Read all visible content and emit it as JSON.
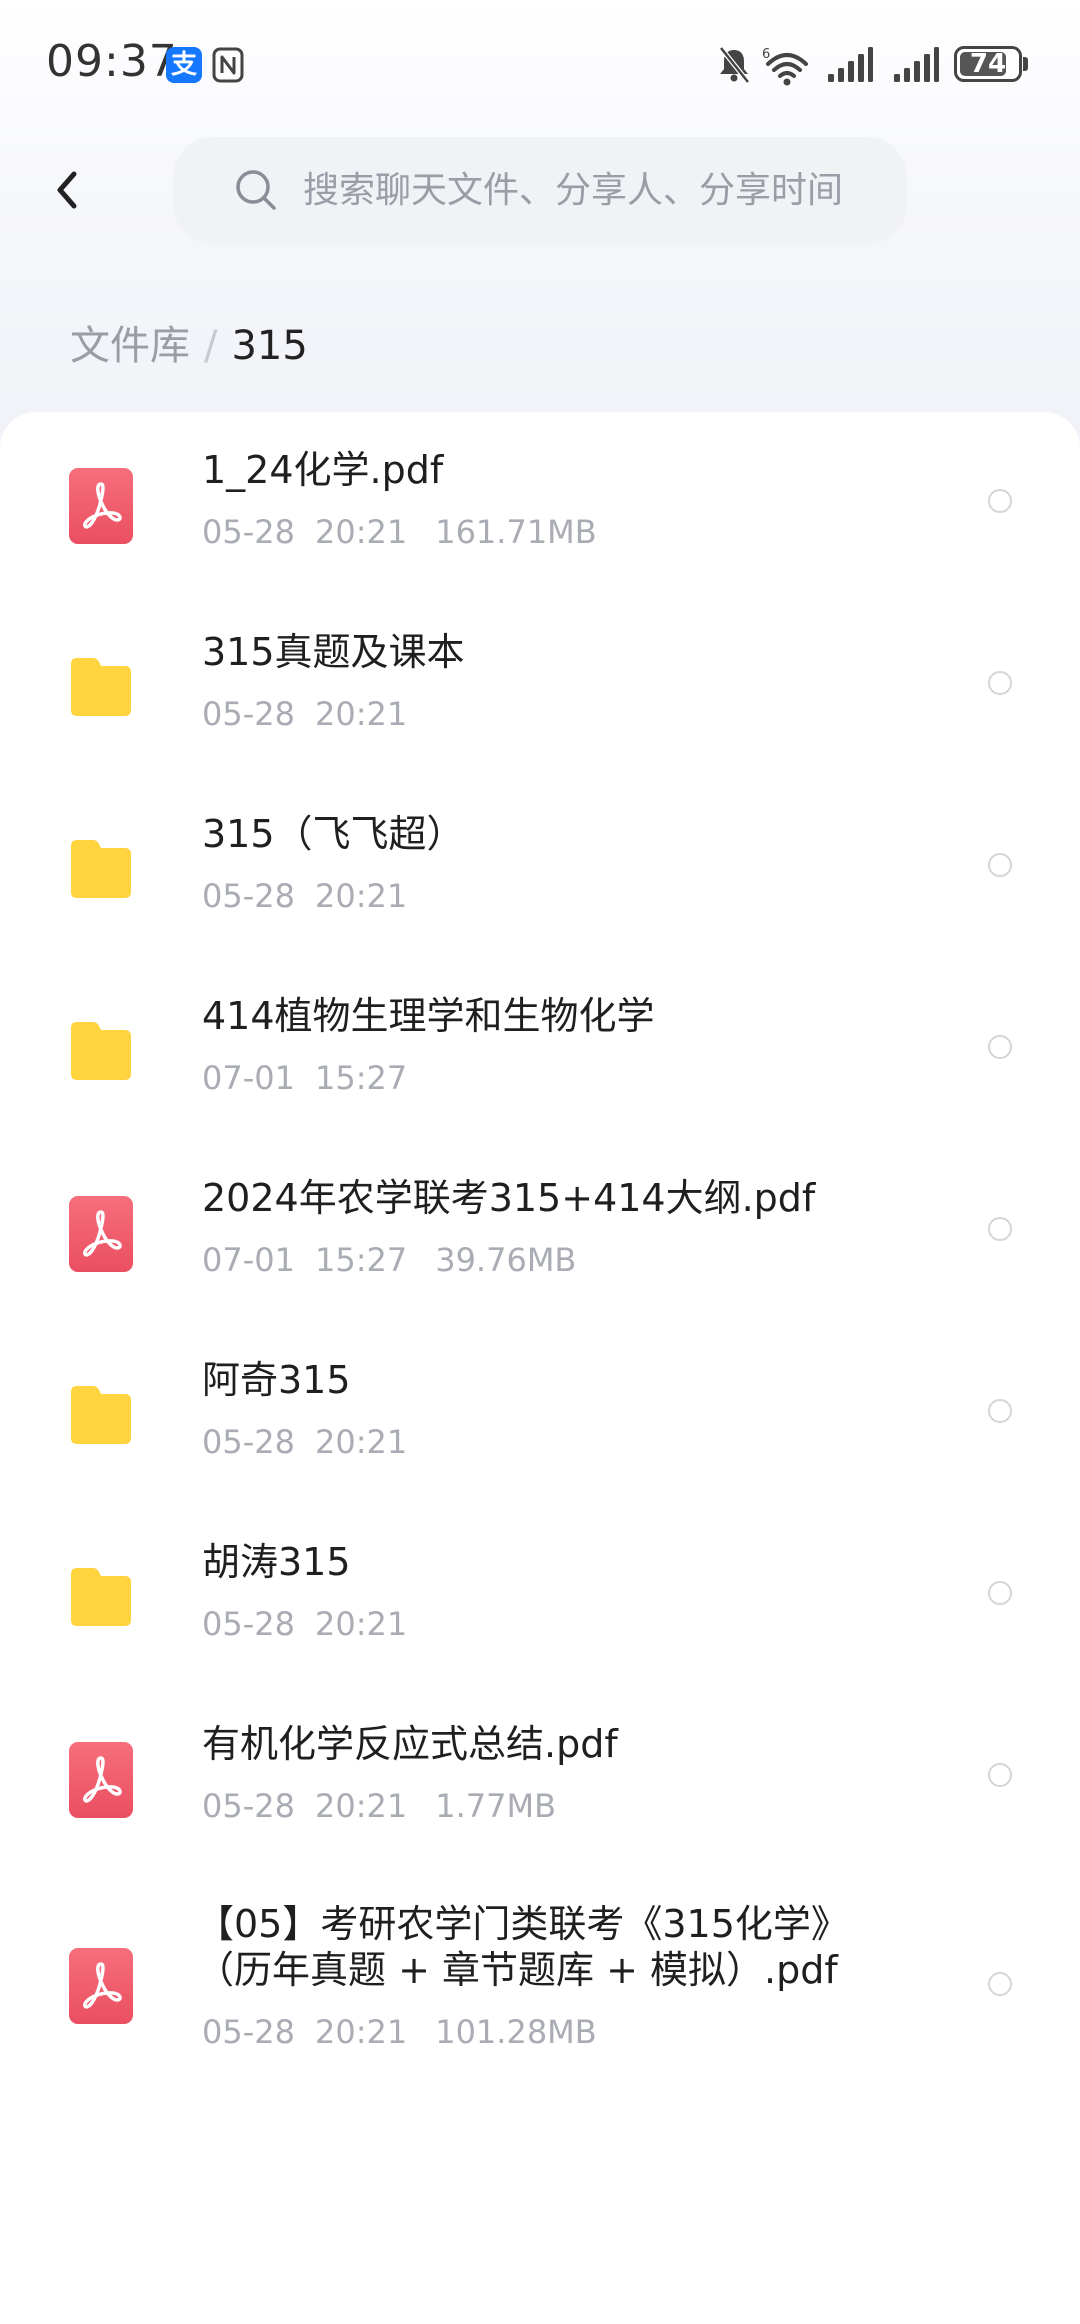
{
  "status_bar": {
    "time": "09:37",
    "alipay_glyph": "支",
    "battery_level": "74",
    "icons": [
      "alipay-icon",
      "nfc-icon",
      "mute-icon",
      "wifi-icon",
      "signal-icon",
      "signal-icon",
      "battery-icon"
    ]
  },
  "search": {
    "placeholder": "搜索聊天文件、分享人、分享时间"
  },
  "breadcrumb": {
    "root": "文件库",
    "separator": "/",
    "current": "315"
  },
  "files": [
    {
      "type": "pdf",
      "name": "1_24化学.pdf",
      "date": "05-28",
      "time": "20:21",
      "size": "161.71MB"
    },
    {
      "type": "folder",
      "name": "315真题及课本",
      "date": "05-28",
      "time": "20:21",
      "size": ""
    },
    {
      "type": "folder",
      "name": "315（飞飞超）",
      "date": "05-28",
      "time": "20:21",
      "size": ""
    },
    {
      "type": "folder",
      "name": "414植物生理学和生物化学",
      "date": "07-01",
      "time": "15:27",
      "size": ""
    },
    {
      "type": "pdf",
      "name": "2024年农学联考315+414大纲.pdf",
      "date": "07-01",
      "time": "15:27",
      "size": "39.76MB"
    },
    {
      "type": "folder",
      "name": "阿奇315",
      "date": "05-28",
      "time": "20:21",
      "size": ""
    },
    {
      "type": "folder",
      "name": "胡涛315",
      "date": "05-28",
      "time": "20:21",
      "size": ""
    },
    {
      "type": "pdf",
      "name": "有机化学反应式总结.pdf",
      "date": "05-28",
      "time": "20:21",
      "size": "1.77MB"
    },
    {
      "type": "pdf",
      "name_line1": "【05】考研农学门类联考《315化学》",
      "name_line2": "（历年真题 + 章节题库 + 模拟）.pdf",
      "date": "05-28",
      "time": "20:21",
      "size": "101.28MB"
    }
  ],
  "colors": {
    "pdf_icon": "#ef5b6b",
    "folder_icon": "#ffd43f",
    "accent_alipay": "#1677ff"
  }
}
